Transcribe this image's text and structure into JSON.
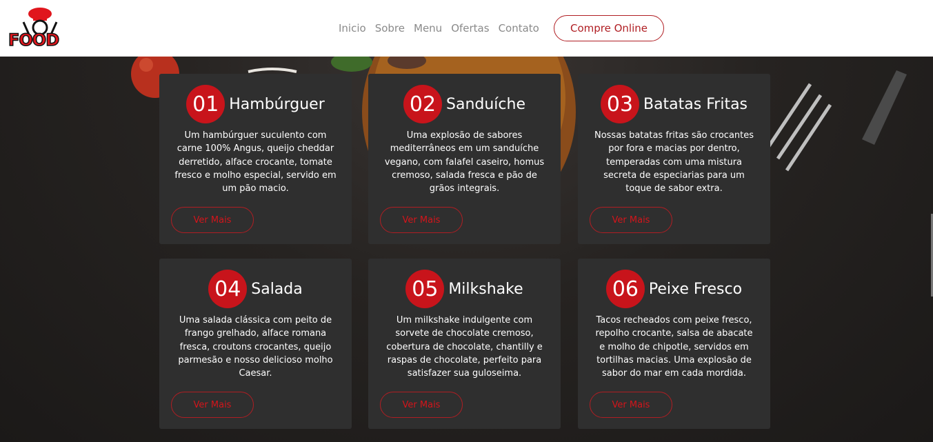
{
  "header": {
    "logo_text": "FOOD",
    "nav": [
      "Inicio",
      "Sobre",
      "Menu",
      "Ofertas",
      "Contato"
    ],
    "cta": "Compre Online"
  },
  "colors": {
    "accent": "#c8141b",
    "card": "#2f2f2f",
    "background": "#1b1918"
  },
  "cards": [
    {
      "num": "01",
      "title": "Hambúrguer",
      "desc": "Um hambúrguer suculento com carne 100% Angus, queijo cheddar derretido, alface crocante, tomate fresco e molho especial, servido em um pão macio.",
      "button": "Ver Mais"
    },
    {
      "num": "02",
      "title": "Sanduíche",
      "desc": "Uma explosão de sabores mediterrâneos em um sanduíche vegano, com falafel caseiro, homus cremoso, salada fresca e pão de grãos integrais.",
      "button": "Ver Mais"
    },
    {
      "num": "03",
      "title": "Batatas Fritas",
      "desc": "Nossas batatas fritas são crocantes por fora e macias por dentro, temperadas com uma mistura secreta de especiarias para um toque de sabor extra.",
      "button": "Ver Mais"
    },
    {
      "num": "04",
      "title": "Salada",
      "desc": "Uma salada clássica com peito de frango grelhado, alface romana fresca, croutons crocantes, queijo parmesão e nosso delicioso molho Caesar.",
      "button": "Ver Mais"
    },
    {
      "num": "05",
      "title": "Milkshake",
      "desc": "Um milkshake indulgente com sorvete de chocolate cremoso, cobertura de chocolate, chantilly e raspas de chocolate, perfeito para satisfazer sua guloseima.",
      "button": "Ver Mais"
    },
    {
      "num": "06",
      "title": "Peixe Fresco",
      "desc": "Tacos recheados com peixe fresco, repolho crocante, salsa de abacate e molho de chipotle, servidos em tortilhas macias. Uma explosão de sabor do mar em cada mordida.",
      "button": "Ver Mais"
    }
  ]
}
